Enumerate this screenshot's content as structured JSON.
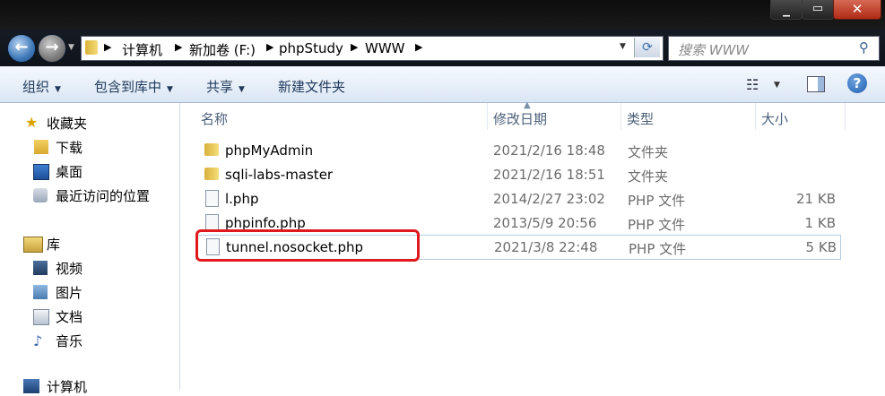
{
  "window": {
    "title": ""
  },
  "address": {
    "crumbs": [
      "计算机",
      "新加卷 (F:)",
      "phpStudy",
      "WWW"
    ]
  },
  "search": {
    "placeholder": "搜索 WWW"
  },
  "toolbar": {
    "organize": "组织",
    "include_in_library": "包含到库中",
    "share": "共享",
    "new_folder": "新建文件夹"
  },
  "navpane": {
    "favorites": {
      "label": "收藏夹",
      "items": [
        "下载",
        "桌面",
        "最近访问的位置"
      ]
    },
    "libraries": {
      "label": "库",
      "items": [
        "视频",
        "图片",
        "文档",
        "音乐"
      ]
    },
    "computer": {
      "label": "计算机"
    }
  },
  "columns": {
    "name": "名称",
    "date": "修改日期",
    "type": "类型",
    "size": "大小"
  },
  "files": [
    {
      "name": "phpMyAdmin",
      "date": "2021/2/16 18:48",
      "type": "文件夹",
      "size": "",
      "kind": "folder"
    },
    {
      "name": "sqli-labs-master",
      "date": "2021/2/16 18:51",
      "type": "文件夹",
      "size": "",
      "kind": "folder"
    },
    {
      "name": "l.php",
      "date": "2014/2/27 23:02",
      "type": "PHP 文件",
      "size": "21 KB",
      "kind": "php"
    },
    {
      "name": "phpinfo.php",
      "date": "2013/5/9 20:56",
      "type": "PHP 文件",
      "size": "1 KB",
      "kind": "php"
    },
    {
      "name": "tunnel.nosocket.php",
      "date": "2021/3/8 22:48",
      "type": "PHP 文件",
      "size": "5 KB",
      "kind": "php"
    }
  ],
  "colors": {
    "highlight": "#e0191e",
    "toolbar_text": "#1e395b",
    "title_bar": "#111111"
  }
}
